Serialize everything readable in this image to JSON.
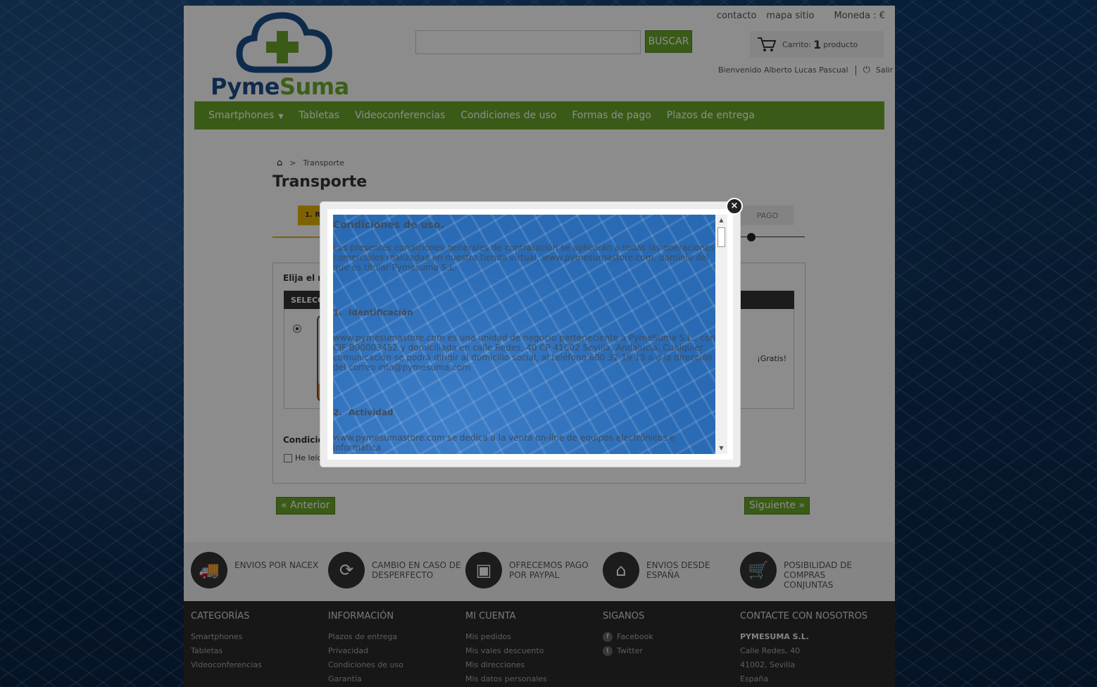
{
  "header": {
    "logo_text_a": "Pyme",
    "logo_text_b": "Suma",
    "search_button": "BUSCAR",
    "search_placeholder": "",
    "top_links": [
      "contacto",
      "mapa sitio"
    ],
    "currency": "Moneda : €",
    "cart_label": "Carrito:",
    "cart_count": "1",
    "cart_unit": "producto",
    "welcome": "Bienvenido Alberto Lucas Pascual",
    "logout": "Salir"
  },
  "nav": {
    "items": [
      "Smartphones",
      "Tabletas",
      "Videoconferencias",
      "Condiciones de uso",
      "Formas de pago",
      "Plazos de entrega"
    ]
  },
  "breadcrumb": {
    "sep": ">",
    "current": "Transporte"
  },
  "page_title": "Transporte",
  "steps": {
    "first": "1. RES",
    "last": "PAGO"
  },
  "carrier": {
    "prompt": "Elija el mo",
    "head": "SELECCIÓ",
    "price": "¡Gratis!",
    "conditions_label": "Condicione",
    "agree_label": "He leído"
  },
  "buttons": {
    "prev": "« Anterior",
    "next": "Siguiente »"
  },
  "modal": {
    "title": "Condiciones de uso.",
    "intro": "Las presentes condiciones generales de contratación se aplicarán a todas las operaciones comerciales realizadas en nuestra tienda virtual, www.pymesumastore.com, dominio del que es titular Pymesuma S.L.",
    "s1_num": "1.",
    "s1_title": "Identificación",
    "s1_body": "www.pymesumastore.com es una unidad de negocio perteneciente a PymeSuma S.L., con CIF B90003452 y domiciliada en calle Redes, 40 CP 41002 Sevilla, Andalucía. Cualquier comunicación se podrá dirigir al domicilio social, al teléfono 600 32 19 15 o a la dirección del correo info@pymesuma.com",
    "s2_num": "2.",
    "s2_title": "Actividad",
    "s2_body": "www.pymesumastore.com se dedica a la venta on-line de equipos electrónicos e informática",
    "close": "×"
  },
  "features": [
    {
      "icon": "truck-icon",
      "glyph": "🚚",
      "text": "ENVIOS POR NACEX"
    },
    {
      "icon": "refresh-icon",
      "glyph": "⟳",
      "text": "CAMBIO EN CASO DE DESPERFECTO"
    },
    {
      "icon": "card-icon",
      "glyph": "▣",
      "text": "OFRECEMOS PAGO POR PAYPAL"
    },
    {
      "icon": "home-icon",
      "glyph": "⌂",
      "text": "ENVIOS DESDE ESPAÑA"
    },
    {
      "icon": "cart-icon",
      "glyph": "🛒",
      "text": "POSIBILIDAD DE COMPRAS CONJUNTAS"
    }
  ],
  "footer": {
    "categorias": {
      "title": "CATEGORÍAS",
      "items": [
        "Smartphones",
        "Tabletas",
        "Videoconferencias"
      ]
    },
    "informacion": {
      "title": "INFORMACIÓN",
      "items": [
        "Plazos de entrega",
        "Privacidad",
        "Condiciones de uso",
        "Garantía"
      ]
    },
    "cuenta": {
      "title": "MI CUENTA",
      "items": [
        "Mis pedidos",
        "Mis vales descuento",
        "Mis direcciones",
        "Mis datos personales"
      ]
    },
    "siganos": {
      "title": "SIGANOS",
      "items": [
        "Facebook",
        "Twitter"
      ]
    },
    "contacto": {
      "title": "CONTACTE CON NOSOTROS",
      "company": "PYMESUMA S.L.",
      "items": [
        "Calle Redes, 40",
        "41002, Sevilla",
        "España"
      ]
    }
  },
  "colors": {
    "brand_green": "#6aa62a",
    "brand_blue": "#1c4f8a",
    "step_yellow": "#e8b400"
  }
}
